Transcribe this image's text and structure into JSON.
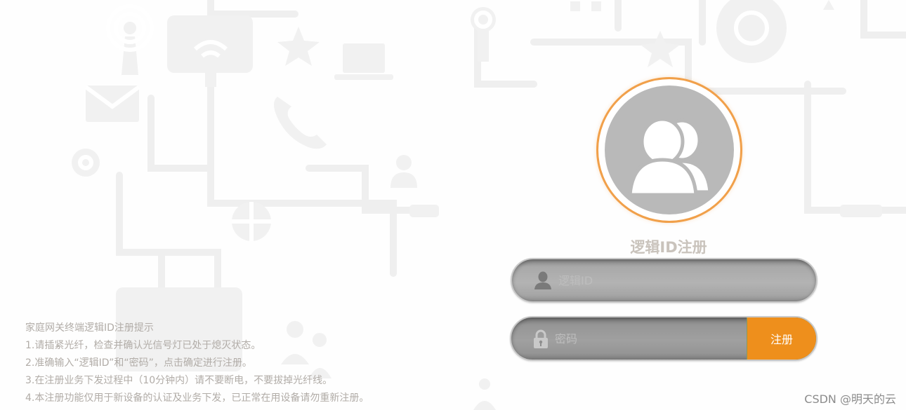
{
  "form": {
    "title": "逻辑ID注册",
    "logic_id_placeholder": "逻辑ID",
    "password_placeholder": "密码",
    "submit_label": "注册"
  },
  "tips": {
    "heading": "家庭网关终端逻辑ID注册提示",
    "items": [
      "1.请插紧光纤，检查并确认光信号灯已处于熄灭状态。",
      "2.准确输入“逻辑ID”和“密码”，点击确定进行注册。",
      "3.在注册业务下发过程中（10分钟内）请不要断电，不要拔掉光纤线。",
      "4.本注册功能仅用于新设备的认证及业务下发，已正常在用设备请勿重新注册。"
    ]
  },
  "watermark": "CSDN @明天的云",
  "icons": {
    "avatar": "users-icon",
    "user_field": "user-icon",
    "password_field": "lock-icon"
  },
  "colors": {
    "accent": "#ee8f1c",
    "ring": "#f1a04a",
    "avatar_bg": "#b9b9b9",
    "field_bg": "#b3b3b3",
    "title_text": "#c9c3bc",
    "tip_text": "#b1aca7"
  }
}
